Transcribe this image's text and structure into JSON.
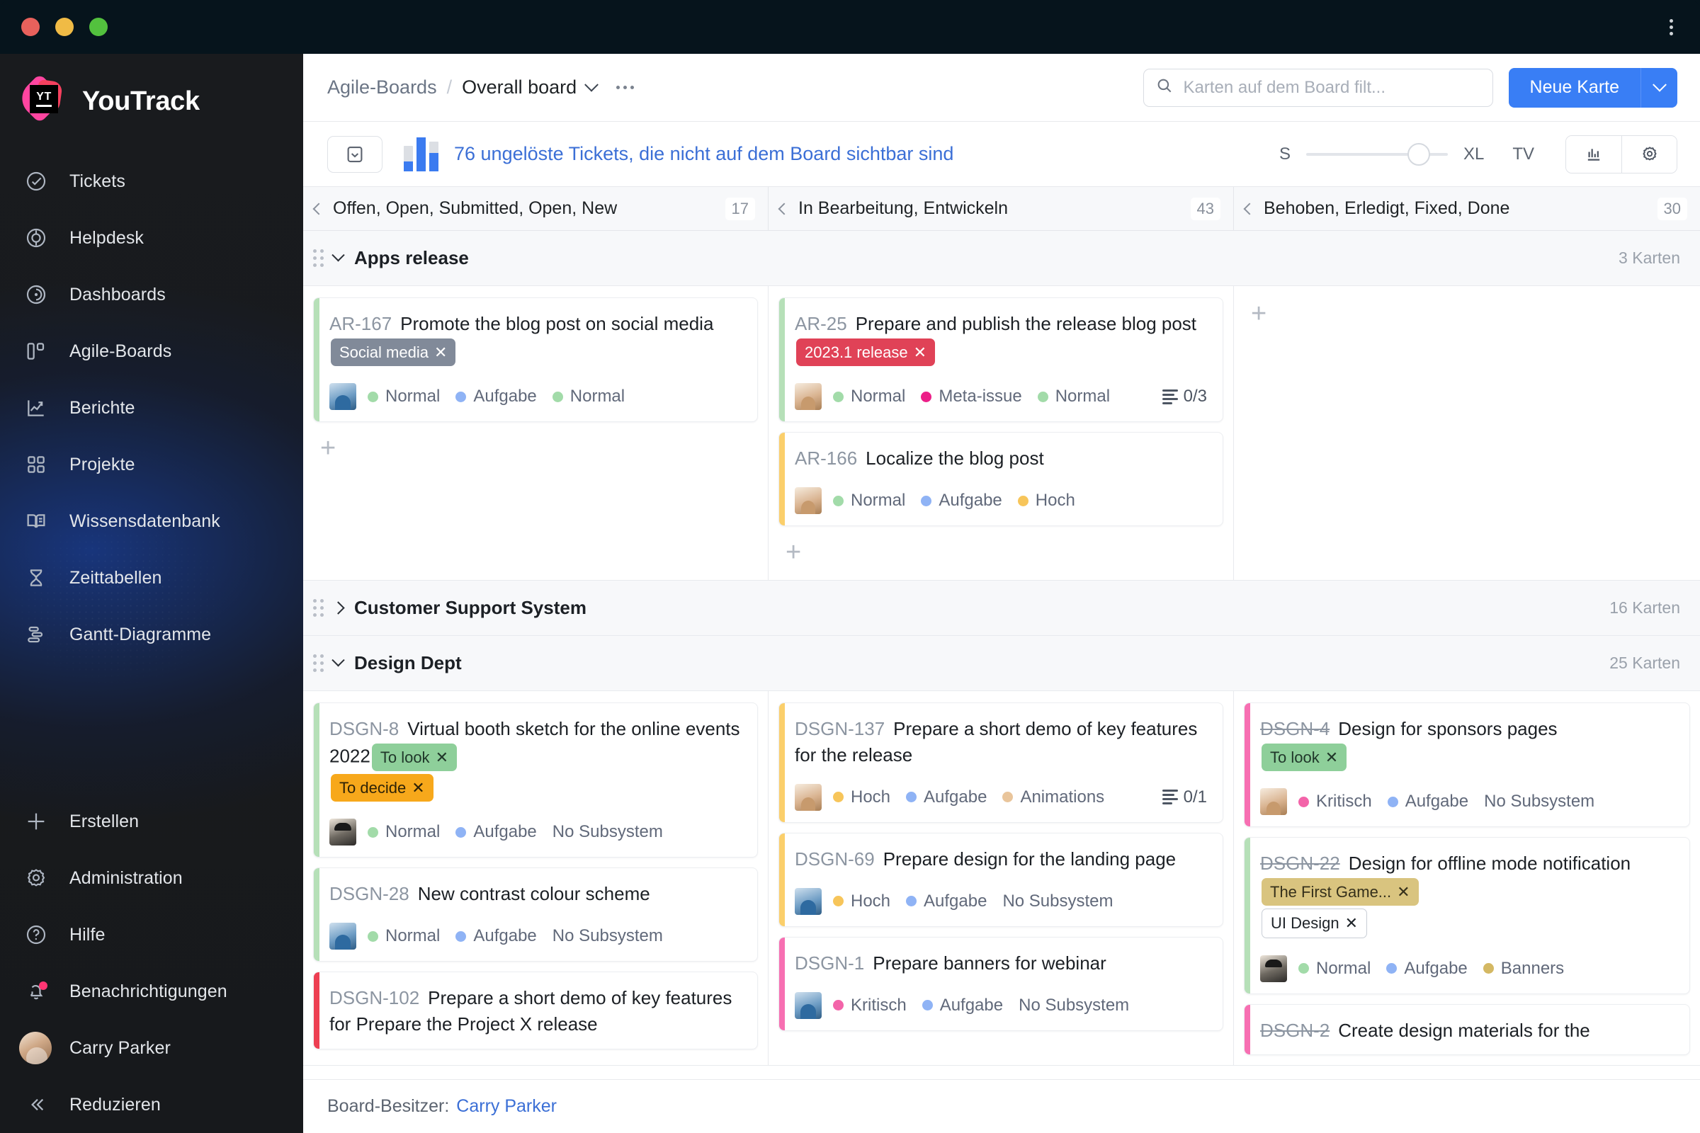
{
  "window": {
    "kebab_icon": "kebab-menu-icon"
  },
  "sidebar": {
    "brand": "YouTrack",
    "items": [
      {
        "label": "Tickets",
        "icon": "check-circle-icon"
      },
      {
        "label": "Helpdesk",
        "icon": "lifebuoy-icon"
      },
      {
        "label": "Dashboards",
        "icon": "radar-icon"
      },
      {
        "label": "Agile-Boards",
        "icon": "board-columns-icon"
      },
      {
        "label": "Berichte",
        "icon": "chart-line-icon"
      },
      {
        "label": "Projekte",
        "icon": "grid-icon"
      },
      {
        "label": "Wissensdatenbank",
        "icon": "book-icon"
      },
      {
        "label": "Zeittabellen",
        "icon": "hourglass-icon"
      },
      {
        "label": "Gantt-Diagramme",
        "icon": "gantt-icon"
      }
    ],
    "bottom_items": [
      {
        "label": "Erstellen",
        "icon": "plus-icon"
      },
      {
        "label": "Administration",
        "icon": "gear-icon"
      },
      {
        "label": "Hilfe",
        "icon": "question-circle-icon"
      },
      {
        "label": "Benachrichtigungen",
        "icon": "bell-icon"
      }
    ],
    "user": "Carry Parker",
    "collapse": "Reduzieren"
  },
  "header": {
    "breadcrumb_root": "Agile-Boards",
    "breadcrumb_sep": "/",
    "breadcrumb_current": "Overall board",
    "search_placeholder": "Karten auf dem Board filt...",
    "search_value": "",
    "new_card_label": "Neue Karte"
  },
  "toolbar": {
    "inbox_icon": "inbox-icon",
    "chart_icon": "bar-chart-icon",
    "unresolved_text": "76 ungelöste Tickets, die nicht auf dem Board sichtbar sind",
    "size_min": "S",
    "size_max": "XL",
    "tv_label": "TV",
    "chart_toggle_icon": "column-chart-icon",
    "settings_icon": "gear-icon"
  },
  "columns": [
    {
      "title": "Offen, Open, Submitted, Open, New",
      "count": "17"
    },
    {
      "title": "In Bearbeitung, Entwickeln",
      "count": "43"
    },
    {
      "title": "Behoben, Erledigt, Fixed, Done",
      "count": "30"
    }
  ],
  "swimlanes": [
    {
      "title": "Apps release",
      "count": "3 Karten",
      "collapsed": false,
      "cols": [
        {
          "cards": [
            {
              "id": "AR-167",
              "struck": false,
              "accent": "green",
              "title": "Promote the blog post on social media",
              "tags": [
                {
                  "text": "Social media",
                  "style": "gray",
                  "close": "✕"
                }
              ],
              "avatar": "a",
              "meta": [
                {
                  "label": "Normal",
                  "dot": "green"
                },
                {
                  "label": "Aufgabe",
                  "dot": "blue"
                },
                {
                  "label": "Normal",
                  "dot": "green"
                }
              ],
              "subtask": ""
            }
          ],
          "add": "+"
        },
        {
          "cards": [
            {
              "id": "AR-25",
              "struck": false,
              "accent": "green",
              "title": "Prepare and publish the release blog post",
              "tags": [
                {
                  "text": "2023.1 release",
                  "style": "red",
                  "close": "✕"
                }
              ],
              "avatar": "b",
              "meta": [
                {
                  "label": "Normal",
                  "dot": "green"
                },
                {
                  "label": "Meta-issue",
                  "dot": "pink"
                },
                {
                  "label": "Normal",
                  "dot": "green"
                }
              ],
              "subtask": "0/3"
            },
            {
              "id": "AR-166",
              "struck": false,
              "accent": "yellow",
              "title": "Localize the blog post",
              "tags": [],
              "avatar": "b",
              "meta": [
                {
                  "label": "Normal",
                  "dot": "green"
                },
                {
                  "label": "Aufgabe",
                  "dot": "blue"
                },
                {
                  "label": "Hoch",
                  "dot": "yellow"
                }
              ],
              "subtask": ""
            }
          ],
          "add": "+"
        },
        {
          "cards": [],
          "add": "+"
        }
      ]
    },
    {
      "title": "Customer Support System",
      "count": "16 Karten",
      "collapsed": true,
      "cols": []
    },
    {
      "title": "Design Dept",
      "count": "25 Karten",
      "collapsed": false,
      "cols": [
        {
          "cards": [
            {
              "id": "DSGN-8",
              "struck": false,
              "accent": "green",
              "title": "Virtual booth sketch for the online events 2022",
              "tags": [
                {
                  "text": "To look",
                  "style": "green",
                  "close": "✕"
                },
                {
                  "text": "To decide",
                  "style": "orange",
                  "close": "✕",
                  "newline": true
                }
              ],
              "avatar": "c",
              "meta": [
                {
                  "label": "Normal",
                  "dot": "green"
                },
                {
                  "label": "Aufgabe",
                  "dot": "blue"
                },
                {
                  "label": "No Subsystem",
                  "dot": ""
                }
              ],
              "subtask": ""
            },
            {
              "id": "DSGN-28",
              "struck": false,
              "accent": "green",
              "title": "New contrast colour scheme",
              "tags": [],
              "avatar": "a",
              "meta": [
                {
                  "label": "Normal",
                  "dot": "green"
                },
                {
                  "label": "Aufgabe",
                  "dot": "blue"
                },
                {
                  "label": "No Subsystem",
                  "dot": ""
                }
              ],
              "subtask": ""
            },
            {
              "id": "DSGN-102",
              "struck": false,
              "accent": "red",
              "title": "Prepare a short demo of key features for Prepare the Project X release",
              "tags": [],
              "avatar": "",
              "meta": [],
              "subtask": ""
            }
          ],
          "add": ""
        },
        {
          "cards": [
            {
              "id": "DSGN-137",
              "struck": false,
              "accent": "yellow",
              "title": "Prepare a short demo of key features for the release",
              "tags": [],
              "avatar": "b",
              "meta": [
                {
                  "label": "Hoch",
                  "dot": "yellow"
                },
                {
                  "label": "Aufgabe",
                  "dot": "blue"
                },
                {
                  "label": "Animations",
                  "dot": "tan"
                }
              ],
              "subtask": "0/1"
            },
            {
              "id": "DSGN-69",
              "struck": false,
              "accent": "yellow",
              "title": "Prepare design for the landing page",
              "tags": [],
              "avatar": "a",
              "meta": [
                {
                  "label": "Hoch",
                  "dot": "yellow"
                },
                {
                  "label": "Aufgabe",
                  "dot": "blue"
                },
                {
                  "label": "No Subsystem",
                  "dot": ""
                }
              ],
              "subtask": ""
            },
            {
              "id": "DSGN-1",
              "struck": false,
              "accent": "pink",
              "title": "Prepare banners for webinar",
              "tags": [],
              "avatar": "a",
              "meta": [
                {
                  "label": "Kritisch",
                  "dot": "rose"
                },
                {
                  "label": "Aufgabe",
                  "dot": "blue"
                },
                {
                  "label": "No Subsystem",
                  "dot": ""
                }
              ],
              "subtask": ""
            }
          ],
          "add": ""
        },
        {
          "cards": [
            {
              "id": "DSGN-4",
              "struck": true,
              "accent": "pink",
              "title": "Design for sponsors pages",
              "tags": [
                {
                  "text": "To look",
                  "style": "green",
                  "close": "✕",
                  "newline": true
                }
              ],
              "avatar": "b",
              "meta": [
                {
                  "label": "Kritisch",
                  "dot": "rose"
                },
                {
                  "label": "Aufgabe",
                  "dot": "blue"
                },
                {
                  "label": "No Subsystem",
                  "dot": ""
                }
              ],
              "subtask": ""
            },
            {
              "id": "DSGN-22",
              "struck": true,
              "accent": "green",
              "title": "Design for offline mode notification",
              "tags": [
                {
                  "text": "The First Game...",
                  "style": "khaki",
                  "close": "✕"
                },
                {
                  "text": "UI Design",
                  "style": "outline",
                  "close": "✕",
                  "newline": true
                }
              ],
              "avatar": "c",
              "meta": [
                {
                  "label": "Normal",
                  "dot": "green"
                },
                {
                  "label": "Aufgabe",
                  "dot": "blue"
                },
                {
                  "label": "Banners",
                  "dot": "khaki"
                }
              ],
              "subtask": ""
            },
            {
              "id": "DSGN-2",
              "struck": true,
              "accent": "pink",
              "title": "Create design materials for the",
              "tags": [],
              "avatar": "",
              "meta": [],
              "subtask": ""
            }
          ],
          "add": ""
        }
      ]
    }
  ],
  "footer": {
    "label": "Board-Besitzer:",
    "owner": "Carry Parker"
  }
}
